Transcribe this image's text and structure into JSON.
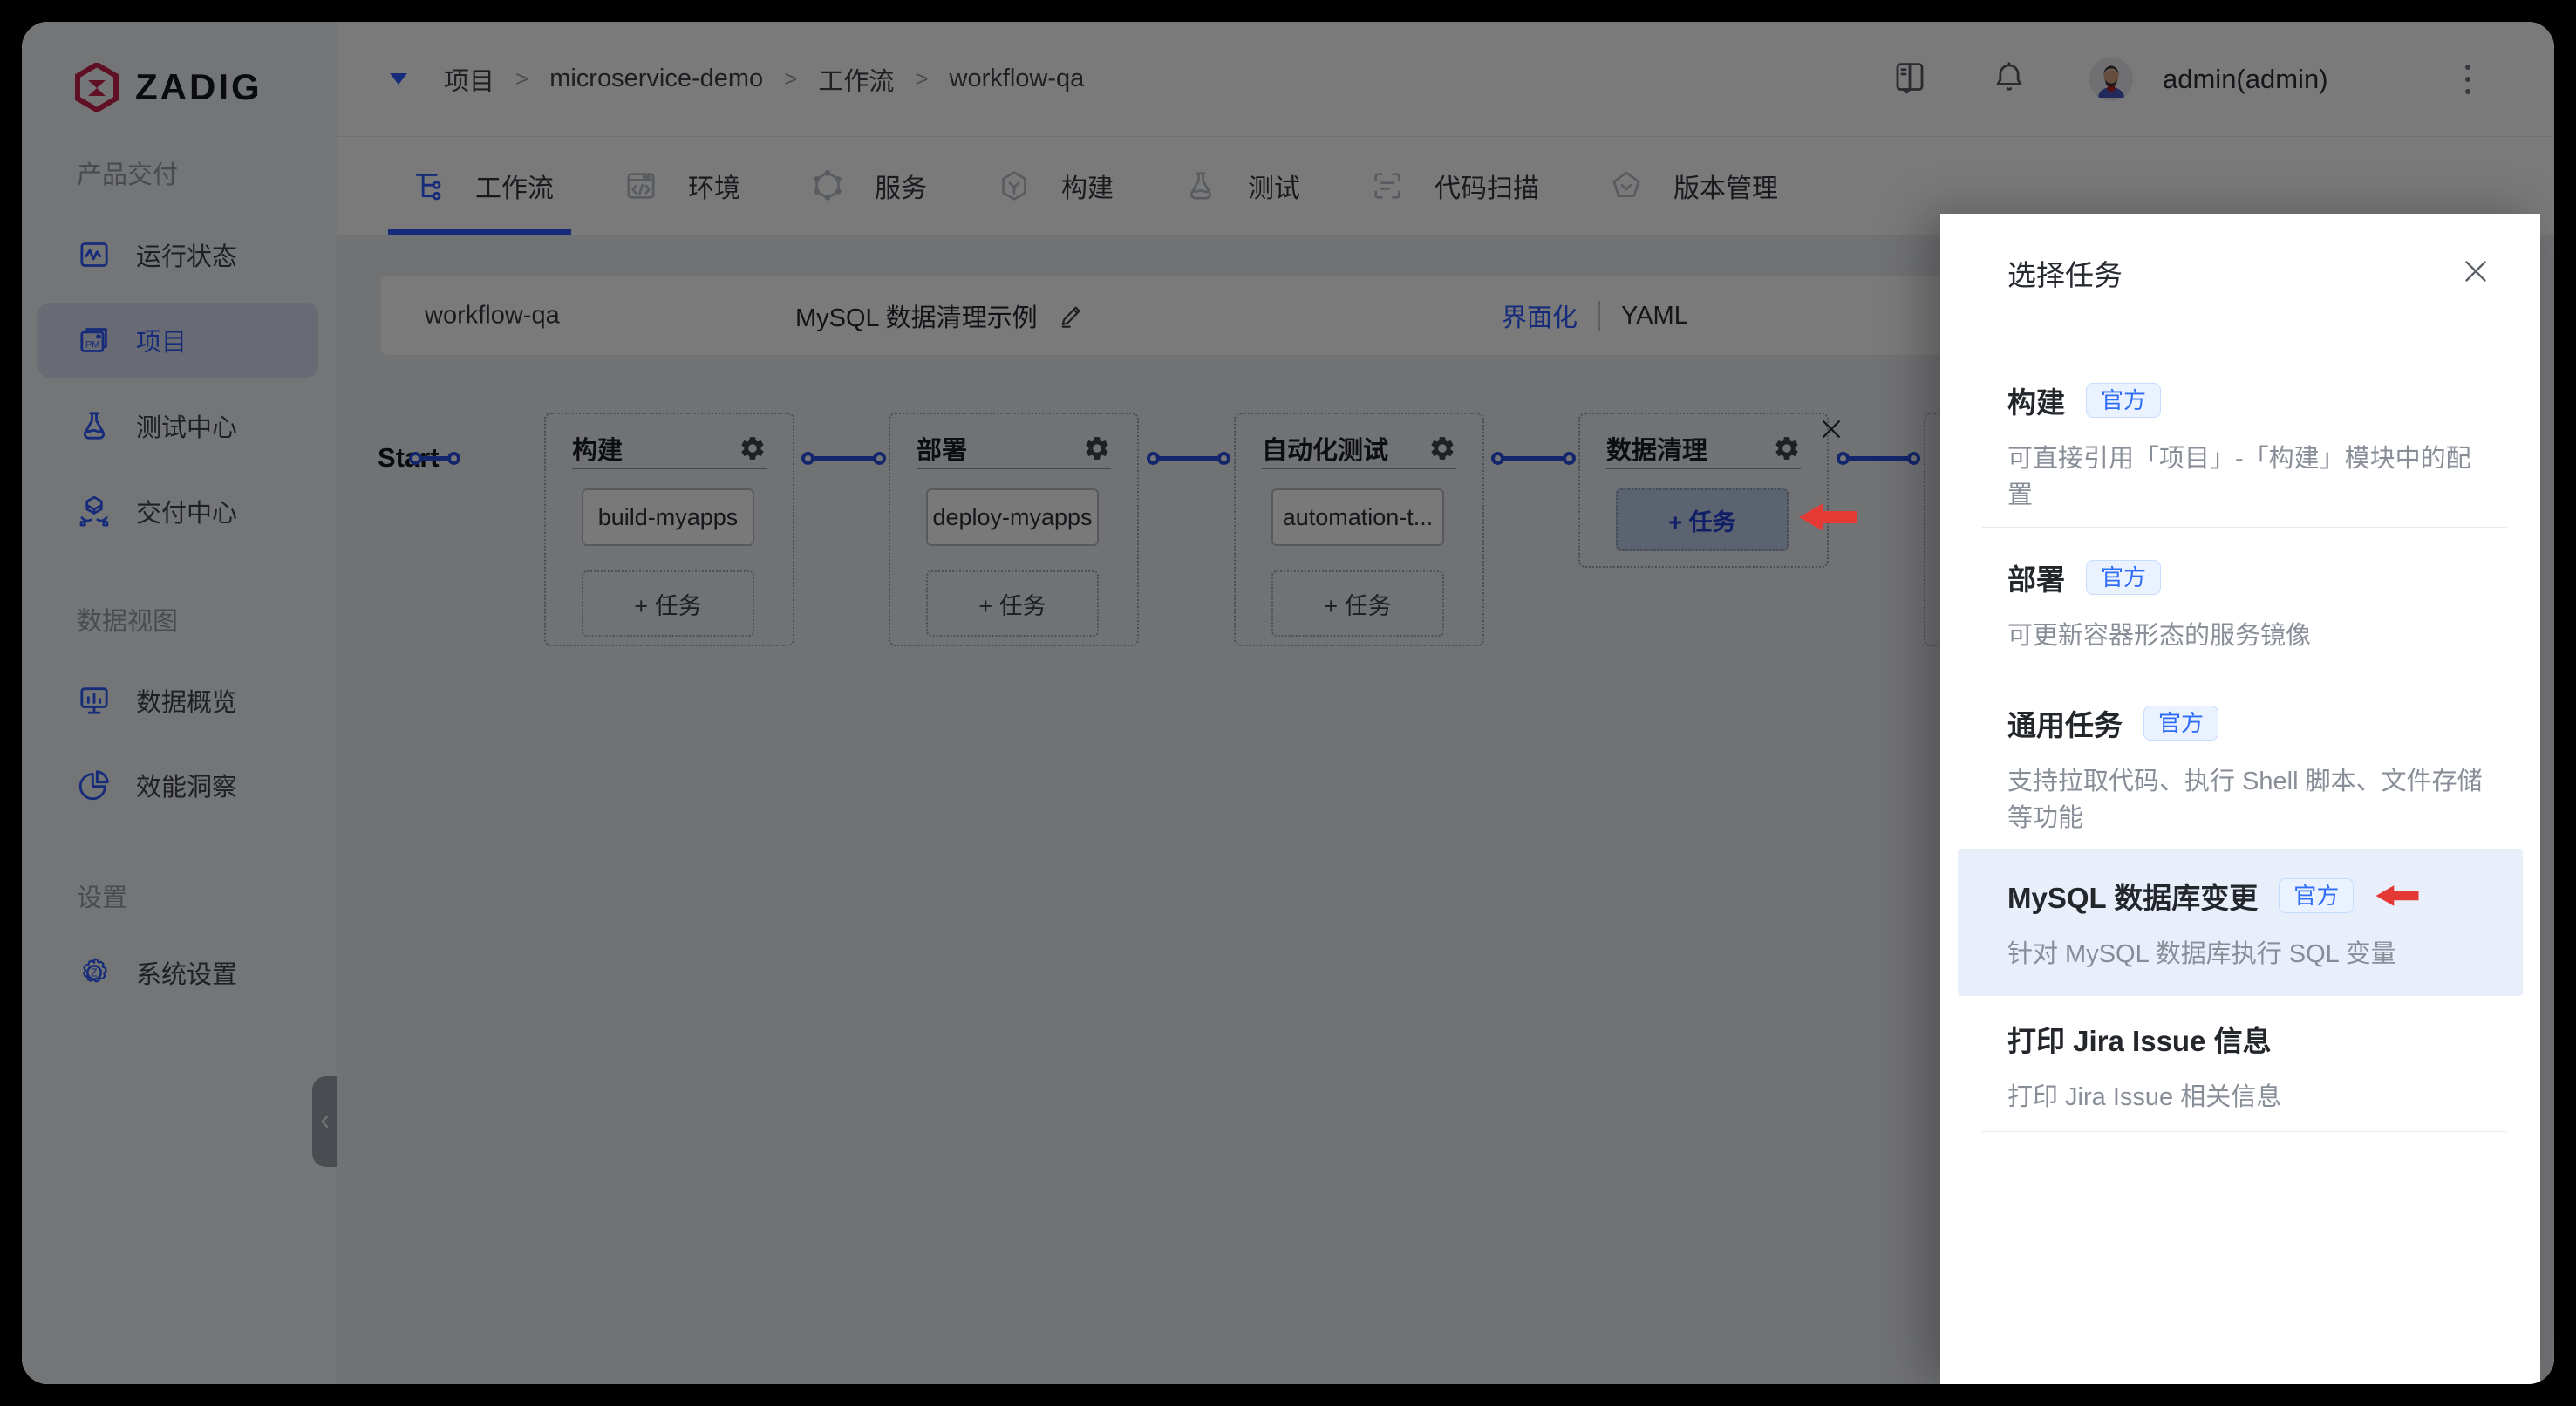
{
  "app": {
    "logo_text": "ZADIG"
  },
  "colors": {
    "accent_blue": "#2f5bff",
    "connector_blue": "#2b50e0",
    "logo_crimson": "#c9234d",
    "arrow_red": "#e53935",
    "badge_blue": "#2f6cf6",
    "badge_bg": "#eaf2ff",
    "highlight_row_bg": "#e9eefb"
  },
  "icons": {
    "logo": "zadig-hexagon",
    "collapse": "chevron-left",
    "breadcrumb_caret": "triangle-down",
    "user_menu": "kebab-vertical"
  },
  "sidebar": {
    "sections": [
      {
        "label": "产品交付",
        "items": [
          {
            "label": "运行状态"
          },
          {
            "label": "项目"
          },
          {
            "label": "测试中心"
          },
          {
            "label": "交付中心"
          }
        ]
      },
      {
        "label": "数据视图",
        "items": [
          {
            "label": "数据概览"
          },
          {
            "label": "效能洞察"
          }
        ]
      },
      {
        "label": "设置",
        "items": [
          {
            "label": "系统设置"
          }
        ]
      }
    ]
  },
  "topbar": {
    "breadcrumb": {
      "items": [
        "项目",
        "microservice-demo",
        "工作流",
        "workflow-qa"
      ],
      "separator": ">"
    },
    "user": "admin(admin)"
  },
  "tabs": [
    {
      "label": "工作流",
      "active": true
    },
    {
      "label": "环境"
    },
    {
      "label": "服务"
    },
    {
      "label": "构建"
    },
    {
      "label": "测试"
    },
    {
      "label": "代码扫描"
    },
    {
      "label": "版本管理"
    }
  ],
  "workflow_header": {
    "name": "workflow-qa",
    "display_name": "MySQL 数据清理示例",
    "mode_ui": "界面化",
    "mode_yaml": "YAML"
  },
  "canvas": {
    "start_label": "Start",
    "stages": [
      {
        "title": "构建",
        "tasks": [
          "build-myapps"
        ],
        "add_label": "+ 任务"
      },
      {
        "title": "部署",
        "tasks": [
          "deploy-myapps"
        ],
        "add_label": "+ 任务"
      },
      {
        "title": "自动化测试",
        "tasks": [
          "automation-t..."
        ],
        "add_label": "+ 任务"
      },
      {
        "title": "数据清理",
        "tasks": [],
        "add_label": "+ 任务"
      }
    ]
  },
  "drawer": {
    "title": "选择任务",
    "official_badge": "官方",
    "items": [
      {
        "title": "构建",
        "badge": "官方",
        "desc": "可直接引用「项目」-「构建」模块中的配置"
      },
      {
        "title": "部署",
        "badge": "官方",
        "desc": "可更新容器形态的服务镜像"
      },
      {
        "title": "通用任务",
        "badge": "官方",
        "desc": "支持拉取代码、执行 Shell 脚本、文件存储等功能"
      },
      {
        "title": "MySQL 数据库变更",
        "badge": "官方",
        "desc": "针对 MySQL 数据库执行 SQL 变量"
      },
      {
        "title": "打印 Jira Issue 信息",
        "badge": "",
        "desc": "打印 Jira Issue 相关信息"
      }
    ]
  }
}
